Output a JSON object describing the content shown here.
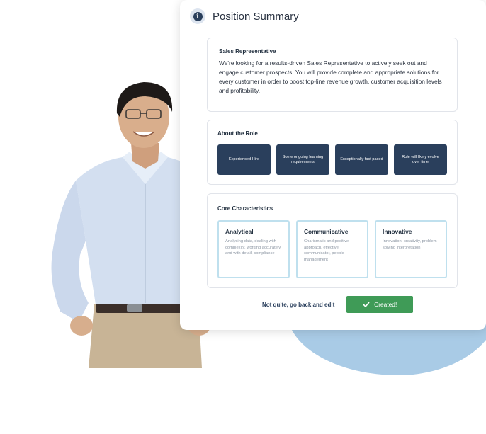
{
  "header": {
    "title": "Position Summary",
    "icon": "info-icon"
  },
  "summary": {
    "title": "Sales Representative",
    "text": "We're looking for a results-driven Sales Representative to actively seek out and engage customer prospects. You will provide complete and appropriate solutions for every customer in order to boost top-line revenue growth, customer acquisition levels and profitability."
  },
  "role": {
    "title": "About the Role",
    "tags": [
      "Experienced Hire",
      "Some ongoing learning requirements",
      "Exceptionally fast paced",
      "Role will likely evolve over time"
    ]
  },
  "characteristics": {
    "title": "Core Characteristics",
    "items": [
      {
        "name": "Analytical",
        "desc": "Analysing data, dealing with complexity, working accurately and with detail, compliance"
      },
      {
        "name": "Communicative",
        "desc": "Charismatic and positive approach, effective communicator, people management"
      },
      {
        "name": "Innovative",
        "desc": "Innovation, creativity, problem solving interpretation"
      }
    ]
  },
  "actions": {
    "back_label": "Not quite, go back and edit",
    "created_label": "Created!",
    "created_icon": "check-icon"
  },
  "colors": {
    "navy": "#2a3f5c",
    "green": "#3f9b57",
    "blob": "#a9cbe6",
    "card_border": "#bfe0ee"
  }
}
